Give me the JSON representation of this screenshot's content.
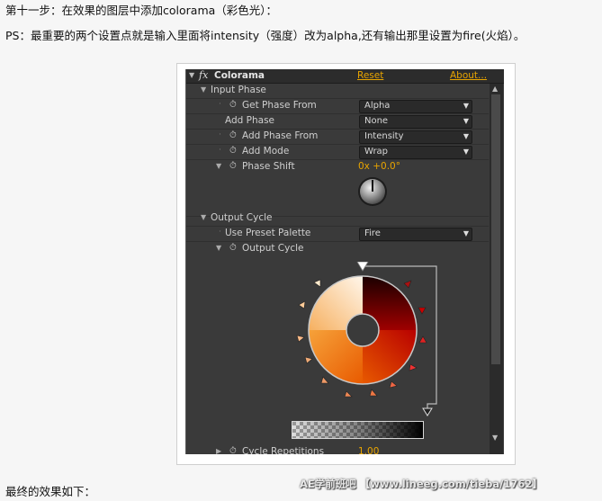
{
  "article": {
    "step_line": "第十一步：在效果的图层中添加colorama（彩色光）：",
    "note_line": "PS：最重要的两个设置点就是输入里面将intensity（强度）改为alpha,还有输出那里设置为fire(火焰）。",
    "final_line": "最终的效果如下：",
    "watermark": "AE学前班吧 【www.lineeg.com/tieba/1762】"
  },
  "panel": {
    "effect_name": "Colorama",
    "fx_symbol": "fx",
    "reset_label": "Reset",
    "about_label": "About...",
    "input_phase": {
      "label": "Input Phase",
      "get_phase_from": {
        "label": "Get Phase From",
        "value": "Alpha"
      },
      "add_phase": {
        "label": "Add Phase",
        "value": "None"
      },
      "add_phase_from": {
        "label": "Add Phase From",
        "value": "Intensity"
      },
      "add_mode": {
        "label": "Add Mode",
        "value": "Wrap"
      },
      "phase_shift": {
        "label": "Phase Shift",
        "value": "0x +0.0°"
      }
    },
    "output_cycle": {
      "label": "Output Cycle",
      "use_preset_palette": {
        "label": "Use Preset Palette",
        "value": "Fire"
      },
      "output_cycle_sub": {
        "label": "Output Cycle"
      }
    },
    "cycle_repetitions": {
      "label": "Cycle Repetitions",
      "value": "1.00"
    }
  },
  "icons": {
    "twirl_open": "▼",
    "twirl_closed": "▶",
    "stopwatch": "⏱",
    "dropdown_arrow": "▼"
  },
  "colors": {
    "accent": "#e8a400",
    "panel_bg": "#3a3a3a"
  }
}
